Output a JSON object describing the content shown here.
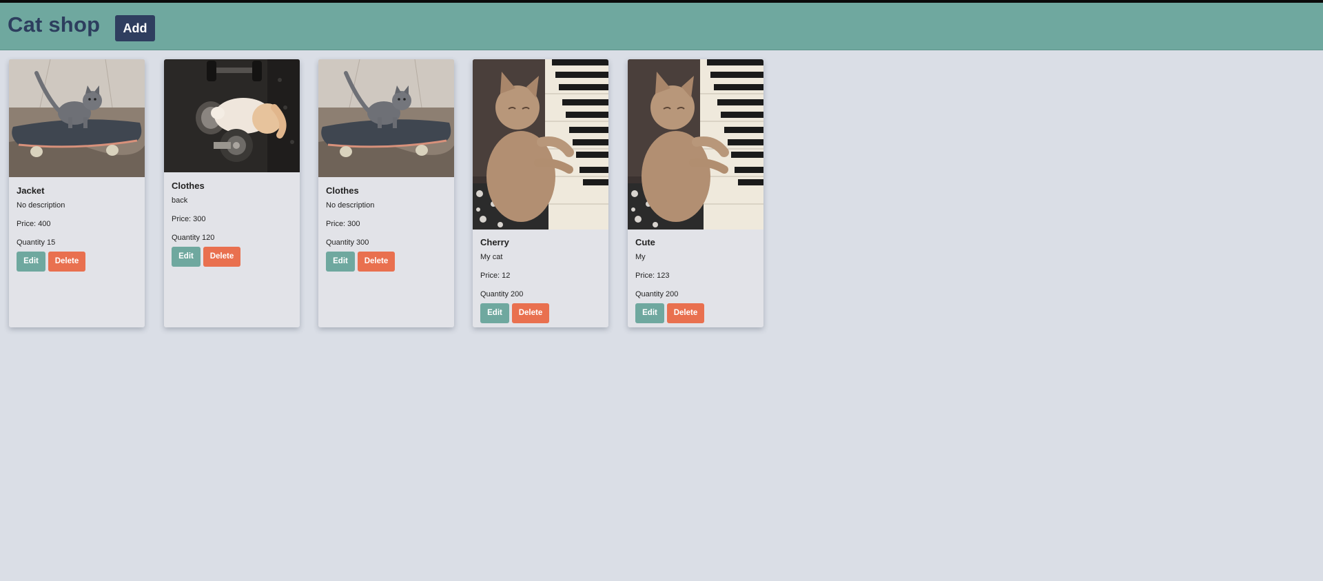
{
  "header": {
    "brand": "Cat shop",
    "add_label": "Add"
  },
  "colors": {
    "header_bg": "#6fa89f",
    "brand_text": "#2d3e5e",
    "add_button": "#2f3e5f",
    "edit_button": "#6fa89f",
    "delete_button": "#e9704f",
    "page_bg": "#dadee6",
    "card_bg": "#e2e3e8"
  },
  "products": [
    {
      "image": "kitten-on-skateboard",
      "title": "Jacket",
      "description": "No description",
      "price": "Price: 400",
      "quantity": "Quantity 15",
      "edit_label": "Edit",
      "delete_label": "Delete"
    },
    {
      "image": "kitten-with-dumbbell",
      "title": "Clothes",
      "description": "back",
      "price": "Price: 300",
      "quantity": "Quantity 120",
      "edit_label": "Edit",
      "delete_label": "Delete"
    },
    {
      "image": "kitten-on-skateboard",
      "title": "Clothes",
      "description": "No description",
      "price": "Price: 300",
      "quantity": "Quantity 300",
      "edit_label": "Edit",
      "delete_label": "Delete"
    },
    {
      "image": "kitten-at-piano",
      "title": "Cherry",
      "description": "My cat",
      "price": "Price: 12",
      "quantity": "Quantity 200",
      "edit_label": "Edit",
      "delete_label": "Delete"
    },
    {
      "image": "kitten-at-piano",
      "title": "Cute",
      "description": "My",
      "price": "Price: 123",
      "quantity": "Quantity 200",
      "edit_label": "Edit",
      "delete_label": "Delete"
    }
  ]
}
